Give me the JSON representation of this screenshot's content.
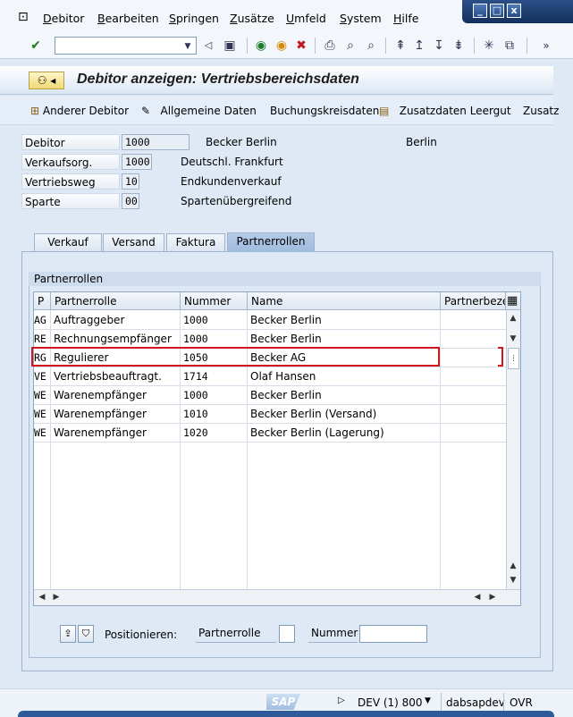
{
  "menu": [
    "Debitor",
    "Bearbeiten",
    "Springen",
    "Zusätze",
    "Umfeld",
    "System",
    "Hilfe"
  ],
  "window_controls": {
    "minimize": "_",
    "maximize": "□",
    "close": "x"
  },
  "toolbar": {
    "command_value": "",
    "more": "»"
  },
  "title": "Debitor anzeigen: Vertriebsbereichsdaten",
  "app_toolbar": {
    "other_customer": "Anderer Debitor",
    "general_data": "Allgemeine Daten",
    "company_code_data": "Buchungskreisdaten",
    "additional_data": "Zusatzdaten Leergut",
    "more": "Zusatz"
  },
  "header": {
    "debitor_label": "Debitor",
    "debitor_value": "1000",
    "debitor_name": "Becker Berlin",
    "debitor_city": "Berlin",
    "sales_org_label": "Verkaufsorg.",
    "sales_org_value": "1000",
    "sales_org_text": "Deutschl. Frankfurt",
    "channel_label": "Vertriebsweg",
    "channel_value": "10",
    "channel_text": "Endkundenverkauf",
    "division_label": "Sparte",
    "division_value": "00",
    "division_text": "Spartenübergreifend"
  },
  "tabs": [
    "Verkauf",
    "Versand",
    "Faktura",
    "Partnerrollen"
  ],
  "group_title": "Partnerrollen",
  "table": {
    "columns": [
      "P",
      "Partnerrolle",
      "Nummer",
      "Name",
      "Partnerbeze"
    ],
    "rows": [
      {
        "p": "AG",
        "role": "Auftraggeber",
        "number": "1000",
        "name": "Becker Berlin"
      },
      {
        "p": "RE",
        "role": "Rechnungsempfänger",
        "number": "1000",
        "name": "Becker Berlin"
      },
      {
        "p": "RG",
        "role": "Regulierer",
        "number": "1050",
        "name": "Becker AG"
      },
      {
        "p": "VE",
        "role": "Vertriebsbeauftragt.",
        "number": "1714",
        "name": "Olaf Hansen"
      },
      {
        "p": "WE",
        "role": "Warenempfänger",
        "number": "1000",
        "name": "Becker Berlin"
      },
      {
        "p": "WE",
        "role": "Warenempfänger",
        "number": "1010",
        "name": "Becker Berlin (Versand)"
      },
      {
        "p": "WE",
        "role": "Warenempfänger",
        "number": "1020",
        "name": "Becker Berlin (Lagerung)"
      }
    ]
  },
  "position": {
    "label": "Positionieren:",
    "role_label": "Partnerrolle",
    "role_value": "",
    "number_label": "Nummer",
    "number_value": ""
  },
  "status": {
    "system": "DEV (1) 800",
    "server": "dabsapdev",
    "mode": "OVR",
    "logo": "SAP"
  },
  "colors": {
    "accent": "#d3161d",
    "brand": "#2f5b9b"
  }
}
